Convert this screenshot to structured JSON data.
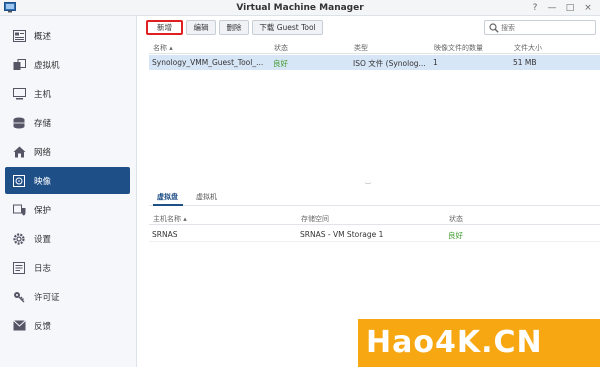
{
  "window": {
    "title": "Virtual Machine Manager",
    "controls": [
      "?",
      "—",
      "□",
      "×"
    ]
  },
  "sidebar": {
    "items": [
      {
        "label": "概述",
        "icon": "overview-icon",
        "active": false
      },
      {
        "label": "虚拟机",
        "icon": "virtual-machine-icon",
        "active": false
      },
      {
        "label": "主机",
        "icon": "host-icon",
        "active": false
      },
      {
        "label": "存储",
        "icon": "storage-icon",
        "active": false
      },
      {
        "label": "网络",
        "icon": "network-icon",
        "active": false
      },
      {
        "label": "映像",
        "icon": "image-icon",
        "active": true
      },
      {
        "label": "保护",
        "icon": "protection-icon",
        "active": false
      },
      {
        "label": "设置",
        "icon": "settings-icon",
        "active": false
      },
      {
        "label": "日志",
        "icon": "log-icon",
        "active": false
      },
      {
        "label": "许可证",
        "icon": "license-icon",
        "active": false
      },
      {
        "label": "反馈",
        "icon": "feedback-icon",
        "active": false
      }
    ]
  },
  "toolbar": {
    "add_label": "新增",
    "edit_label": "编辑",
    "delete_label": "删除",
    "download_label": "下载 Guest Tool",
    "search_placeholder": "搜索"
  },
  "image_table": {
    "columns": [
      "名称 ▴",
      "状态",
      "类型",
      "映像文件的数量",
      "文件大小"
    ],
    "rows": [
      [
        "Synology_VMM_Guest_Tool_...",
        "良好",
        "ISO 文件 (Synolog...",
        "1",
        "51 MB"
      ]
    ]
  },
  "detail_tabs": [
    "虚拟盘",
    "虚拟机"
  ],
  "host_table": {
    "columns": [
      "主机名称 ▴",
      "存储空间",
      "状态"
    ],
    "rows": [
      [
        "SRNAS",
        "SRNAS - VM Storage 1",
        "良好"
      ]
    ]
  },
  "watermark": "Hao4K.CN",
  "colors": {
    "accent": "#1f4f87",
    "status_good": "#3c9a2b",
    "highlight_border": "#e02020",
    "watermark_bg": "#f6a712"
  }
}
